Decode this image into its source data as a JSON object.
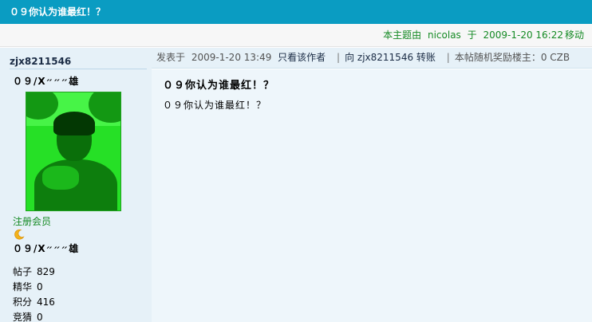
{
  "header": {
    "title": "０９你认为谁最红！？"
  },
  "moderation": {
    "prefix": "本主题由",
    "user": "nicolas",
    "at": "于",
    "datetime": "2009-1-20 16:22",
    "action": "移动"
  },
  "author": {
    "username": "zjx8211546",
    "nickname": "０９/Ⅹ״״״雄",
    "rank": "注册会员",
    "rank_icon": "moon-icon",
    "nickname2": "０９/Ⅹ״״״雄",
    "stats": [
      {
        "label": "帖子",
        "value": "829"
      },
      {
        "label": "精华",
        "value": "0"
      },
      {
        "label": "积分",
        "value": "416"
      },
      {
        "label": "竞猜",
        "value": "0"
      }
    ]
  },
  "post": {
    "posted_label": "发表于",
    "posted_datetime": "2009-1-20 13:49",
    "only_author_link": "只看该作者",
    "to_label": "向",
    "to_user": "zjx8211546",
    "transfer_link": "转账",
    "reward_text": "本帖随机奖励楼主：0 CZB",
    "title": "０９你认为谁最红！？",
    "content": "０９你认为谁最红！？"
  },
  "colors": {
    "title_bar": "#0a9cc2",
    "sidebar_bg": "#e6f1f8",
    "accent_green": "#158a24"
  }
}
